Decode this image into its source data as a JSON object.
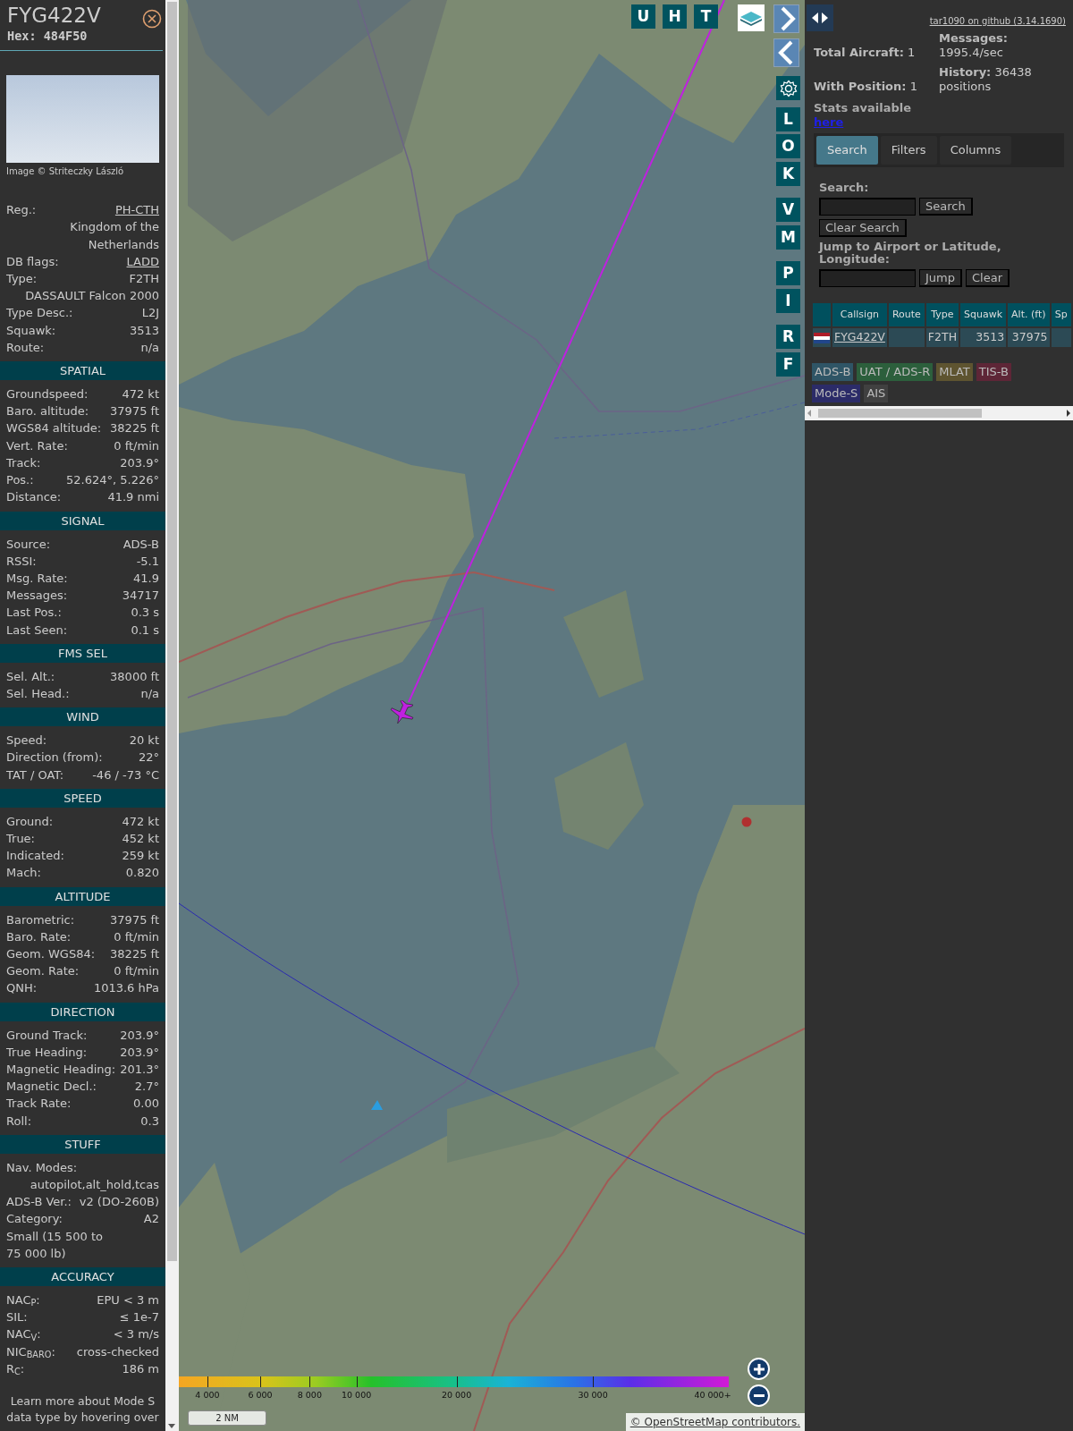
{
  "sidebar": {
    "callsign": "FYG422V",
    "hex": "Hex: 484F50",
    "photo_credit": "Image © Striteczky László",
    "info_rows": [
      {
        "label": "Reg.:",
        "value": "PH-CTH",
        "link": true
      },
      {
        "value": "Kingdom of the Netherlands"
      },
      {
        "label": "DB flags:",
        "value": "LADD",
        "link": true
      },
      {
        "label": "Type:",
        "value": "F2TH"
      },
      {
        "value": "DASSAULT Falcon 2000"
      },
      {
        "label": "Type Desc.:",
        "value": "L2J"
      },
      {
        "label": "Squawk:",
        "value": "3513"
      },
      {
        "label": "Route:",
        "value": "n/a"
      }
    ],
    "sections": [
      {
        "title": "SPATIAL",
        "rows": [
          {
            "label": "Groundspeed:",
            "value": "472 kt"
          },
          {
            "label": "Baro. altitude:",
            "value": "37975 ft"
          },
          {
            "label": "WGS84 altitude:",
            "value": "38225 ft"
          },
          {
            "label": "Vert. Rate:",
            "value": "0 ft/min"
          },
          {
            "label": "Track:",
            "value": "203.9°"
          },
          {
            "label": "Pos.:",
            "value": "52.624°, 5.226°"
          },
          {
            "label": "Distance:",
            "value": "41.9 nmi"
          }
        ]
      },
      {
        "title": "SIGNAL",
        "rows": [
          {
            "label": "Source:",
            "value": "ADS-B"
          },
          {
            "label": "RSSI:",
            "value": "-5.1"
          },
          {
            "label": "Msg. Rate:",
            "value": "41.9"
          },
          {
            "label": "Messages:",
            "value": "34717"
          },
          {
            "label": "Last Pos.:",
            "value": "0.3 s"
          },
          {
            "label": "Last Seen:",
            "value": "0.1 s"
          }
        ]
      },
      {
        "title": "FMS SEL",
        "rows": [
          {
            "label": "Sel. Alt.:",
            "value": "38000 ft"
          },
          {
            "label": "Sel. Head.:",
            "value": "n/a"
          }
        ]
      },
      {
        "title": "WIND",
        "rows": [
          {
            "label": "Speed:",
            "value": "20 kt"
          },
          {
            "label": "Direction (from):",
            "value": "22°"
          },
          {
            "label": "TAT / OAT:",
            "value": "-46 / -73 °C"
          }
        ]
      },
      {
        "title": "SPEED",
        "rows": [
          {
            "label": "Ground:",
            "value": "472 kt"
          },
          {
            "label": "True:",
            "value": "452 kt"
          },
          {
            "label": "Indicated:",
            "value": "259 kt"
          },
          {
            "label": "Mach:",
            "value": "0.820"
          }
        ]
      },
      {
        "title": "ALTITUDE",
        "rows": [
          {
            "label": "Barometric:",
            "value": "37975 ft"
          },
          {
            "label": "Baro. Rate:",
            "value": "0 ft/min"
          },
          {
            "label": "Geom. WGS84:",
            "value": "38225 ft"
          },
          {
            "label": "Geom. Rate:",
            "value": "0 ft/min"
          },
          {
            "label": "QNH:",
            "value": "1013.6 hPa"
          }
        ]
      },
      {
        "title": "DIRECTION",
        "rows": [
          {
            "label": "Ground Track:",
            "value": "203.9°"
          },
          {
            "label": "True Heading:",
            "value": "203.9°"
          },
          {
            "label": "Magnetic Heading:",
            "value": "201.3°"
          },
          {
            "label": "Magnetic Decl.:",
            "value": "2.7°"
          },
          {
            "label": "Track Rate:",
            "value": "0.00"
          },
          {
            "label": "Roll:",
            "value": "0.3"
          }
        ]
      },
      {
        "title": "STUFF",
        "rows": [
          {
            "label": "Nav. Modes:"
          },
          {
            "value": "autopilot,alt_hold,tcas"
          },
          {
            "label": "ADS-B Ver.:",
            "value": "v2 (DO-260B)"
          },
          {
            "label": "Category:",
            "value": "A2"
          },
          {
            "label": "Small (15 500 to 75 000 lb)"
          }
        ]
      },
      {
        "title": "ACCURACY",
        "rows": [
          {
            "label": "NAC$_{P}$:",
            "value": "EPU < 3 m"
          },
          {
            "label": "SIL:",
            "value": "≤ 1e-7"
          },
          {
            "label": "NAC$_{V}$:",
            "value": "< 3 m/s"
          },
          {
            "label": "NIC$_{BARO}$:",
            "value": "cross-checked"
          },
          {
            "label": "R$_{C}$:",
            "value": "186 m"
          }
        ]
      }
    ],
    "footer": "Learn more about Mode S data type by hovering over"
  },
  "map": {
    "top_buttons": [
      {
        "label": "U"
      },
      {
        "label": "H"
      },
      {
        "label": "T"
      }
    ],
    "side_buttons": [
      {
        "label": "L"
      },
      {
        "label": "O"
      },
      {
        "label": "K"
      },
      {
        "label": "V"
      },
      {
        "label": "M"
      },
      {
        "label": "P"
      },
      {
        "label": "I"
      },
      {
        "label": "R"
      },
      {
        "label": "F"
      }
    ],
    "legend_ticks": [
      "4 000",
      "6 000",
      "8 000",
      "10 000",
      "20 000",
      "30 000",
      "40 000+"
    ],
    "scale": "2 NM",
    "attribution": "© OpenStreetMap contributors."
  },
  "panel": {
    "github_link": "tar1090 on github (3.14.1690)",
    "stats": [
      {
        "label": "Total Aircraft:",
        "value": "1"
      },
      {
        "label": "Messages:",
        "value": "1995.4/sec"
      },
      {
        "label": "With Position:",
        "value": "1"
      },
      {
        "label": "History:",
        "value": "36438 positions"
      }
    ],
    "stats_text": "Stats available",
    "stats_link": "here",
    "tabs": [
      {
        "label": "Search",
        "selected": true
      },
      {
        "label": "Filters",
        "selected": false
      },
      {
        "label": "Columns",
        "selected": false
      }
    ],
    "search_label": "Search:",
    "search_button": "Search",
    "clear_search_button": "Clear Search",
    "jump_label": "Jump to Airport or Latitude, Longitude:",
    "jump_button": "Jump",
    "clear_button": "Clear",
    "table": {
      "columns": [
        "Callsign",
        "Route",
        "Type",
        "Squawk",
        "Alt. (ft)",
        "Sp"
      ],
      "rows": [
        {
          "callsign": "FYG422V",
          "type": "F2TH",
          "squawk": "3513",
          "altitude": "37975"
        }
      ]
    },
    "source_tags": [
      {
        "label": "ADS-B",
        "color": "#2f5566"
      },
      {
        "label": "UAT / ADS-R",
        "color": "#2c5f3c"
      },
      {
        "label": "MLAT",
        "color": "#5e5430"
      },
      {
        "label": "TIS-B",
        "color": "#5e2637"
      },
      {
        "label": "Mode-S",
        "color": "#2b2b68"
      },
      {
        "label": "AIS",
        "color": "#404040"
      }
    ]
  }
}
